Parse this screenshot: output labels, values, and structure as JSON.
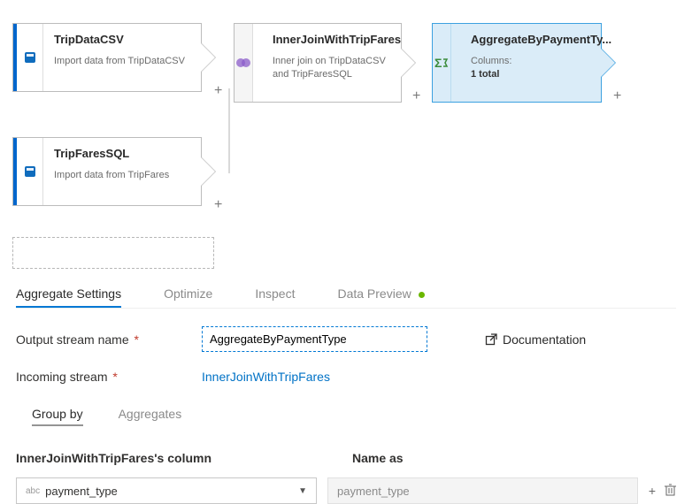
{
  "nodes": {
    "tripData": {
      "title": "TripDataCSV",
      "sub": "Import data from TripDataCSV"
    },
    "tripFares": {
      "title": "TripFaresSQL",
      "sub": "Import data from TripFares"
    },
    "join": {
      "title": "InnerJoinWithTripFares",
      "sub": "Inner join on TripDataCSV and TripFaresSQL"
    },
    "agg": {
      "title": "AggregateByPaymentTy...",
      "sub1": "Columns:",
      "sub2": "1 total"
    }
  },
  "icons": {
    "source": "source-icon",
    "join": "join-icon",
    "aggregate": "aggregate-icon"
  },
  "tabs": {
    "settings": "Aggregate Settings",
    "optimize": "Optimize",
    "inspect": "Inspect",
    "preview": "Data Preview"
  },
  "form": {
    "output_label": "Output stream name",
    "output_value": "AggregateByPaymentType",
    "incoming_label": "Incoming stream",
    "incoming_value": "InnerJoinWithTripFares",
    "documentation": "Documentation"
  },
  "subtabs": {
    "group": "Group by",
    "aggs": "Aggregates"
  },
  "columns": {
    "header_source": "InnerJoinWithTripFares's column",
    "header_name": "Name as",
    "source_col": "payment_type",
    "name_as": "payment_type",
    "type_badge": "abc"
  },
  "actions": {
    "plus": "+",
    "open": "↗",
    "trash": "🗑"
  }
}
